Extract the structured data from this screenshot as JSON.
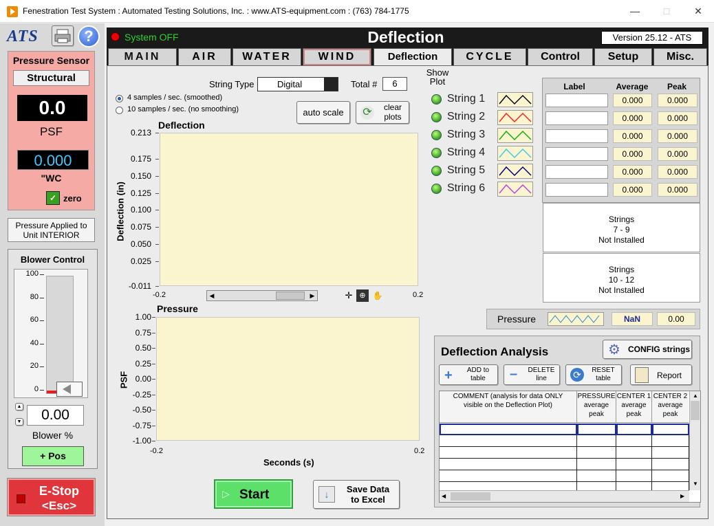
{
  "window": {
    "title": "Fenestration Test System  :  Automated Testing Solutions, Inc.  :  www.ATS-equipment.com  :  (763) 784-1775"
  },
  "left": {
    "logo": "ATS",
    "pressure_sensor": {
      "title": "Pressure Sensor",
      "mode": "Structural",
      "psf_value": "0.0",
      "psf_unit": "PSF",
      "wc_value": "0.000",
      "wc_unit": "\"WC",
      "zero_label": "zero"
    },
    "pressure_applied": "Pressure Applied to Unit INTERIOR",
    "blower": {
      "title": "Blower Control",
      "ticks": [
        "100",
        "80",
        "60",
        "40",
        "20",
        "0"
      ],
      "level_percent": 0,
      "value": "0.00",
      "unit_label": "Blower %",
      "pos_label": "+ Pos"
    },
    "estop": {
      "line1": "E-Stop",
      "line2": "<Esc>"
    }
  },
  "header": {
    "status": "System OFF",
    "title": "Deflection",
    "version": "Version 25.12 - ATS"
  },
  "tabs": [
    "MAIN",
    "AIR",
    "WATER",
    "WIND",
    "Deflection",
    "CYCLE",
    "Control",
    "Setup",
    "Misc."
  ],
  "controls": {
    "string_type_label": "String Type",
    "string_type_value": "Digital",
    "total_label": "Total #",
    "total_value": "6",
    "show_plot_label": "Show Plot",
    "sample_opt1": "4 samples / sec. (smoothed)",
    "sample_opt2": "10 samples / sec. (no smoothing)",
    "auto_scale": "auto scale",
    "clear_plots": "clear plots"
  },
  "deflection_plot": {
    "title": "Deflection",
    "ylabel": "Deflection (in)",
    "yticks": [
      "0.213",
      "0.175",
      "0.150",
      "0.125",
      "0.100",
      "0.075",
      "0.050",
      "0.025",
      "-0.011"
    ],
    "xmin": "-0.2",
    "xmax": "0.2"
  },
  "pressure_plot": {
    "title": "Pressure",
    "ylabel": "PSF",
    "yticks": [
      "1.00",
      "0.75",
      "0.50",
      "0.25",
      "0.00",
      "-0.25",
      "-0.50",
      "-0.75",
      "-1.00"
    ],
    "xmin": "-0.2",
    "xmax": "0.2",
    "xlabel": "Seconds (s)"
  },
  "strings": {
    "headers": {
      "label": "Label",
      "average": "Average",
      "peak": "Peak"
    },
    "items": [
      {
        "name": "String 1",
        "color": "#000000",
        "average": "0.000",
        "peak": "0.000"
      },
      {
        "name": "String 2",
        "color": "#ff2020",
        "average": "0.000",
        "peak": "0.000"
      },
      {
        "name": "String 3",
        "color": "#10b010",
        "average": "0.000",
        "peak": "0.000"
      },
      {
        "name": "String 4",
        "color": "#40c8f0",
        "average": "0.000",
        "peak": "0.000"
      },
      {
        "name": "String 5",
        "color": "#000080",
        "average": "0.000",
        "peak": "0.000"
      },
      {
        "name": "String 6",
        "color": "#c040e0",
        "average": "0.000",
        "peak": "0.000"
      }
    ],
    "not_installed_1": {
      "l1": "Strings",
      "l2": "7 - 9",
      "l3": "Not Installed"
    },
    "not_installed_2": {
      "l1": "Strings",
      "l2": "10 - 12",
      "l3": "Not Installed"
    },
    "pressure_row": {
      "label": "Pressure",
      "average": "NaN",
      "peak": "0.00"
    }
  },
  "analysis": {
    "title": "Deflection Analysis",
    "config": "CONFIG strings",
    "add": "ADD to table",
    "delete": "DELETE line",
    "reset": "RESET table",
    "report": "Report",
    "col_comment": "COMMENT (analysis for data ONLY visible on the Deflection Plot)",
    "col_pressure": "PRESSURE average peak",
    "col_center1": "CENTER 1 average peak",
    "col_center2": "CENTER 2 average peak"
  },
  "bottom": {
    "start": "Start",
    "save_line1": "Save Data",
    "save_line2": "to Excel"
  }
}
